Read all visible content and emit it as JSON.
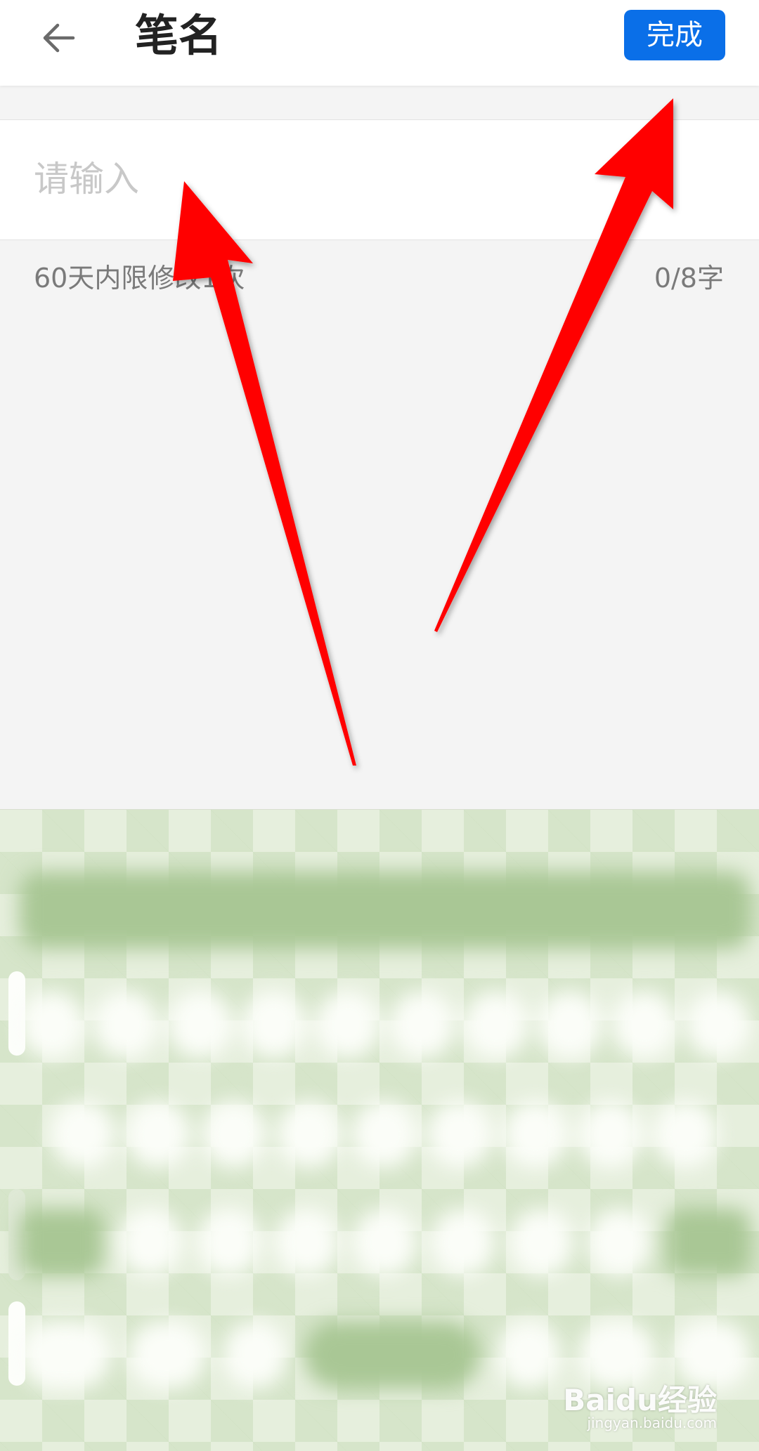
{
  "header": {
    "title": "笔名",
    "done_label": "完成",
    "back_icon": "arrow-left-icon"
  },
  "form": {
    "placeholder": "请输入",
    "value": "",
    "hint": "60天内限修改1次",
    "char_count": "0/8字"
  },
  "keyboard": {
    "state": "blurred",
    "theme_color": "#a9c795"
  },
  "watermark": {
    "brand": "Baidu经验",
    "url": "jingyan.baidu.com"
  },
  "colors": {
    "accent": "#0a6fe8",
    "annotation": "#ff0000"
  }
}
